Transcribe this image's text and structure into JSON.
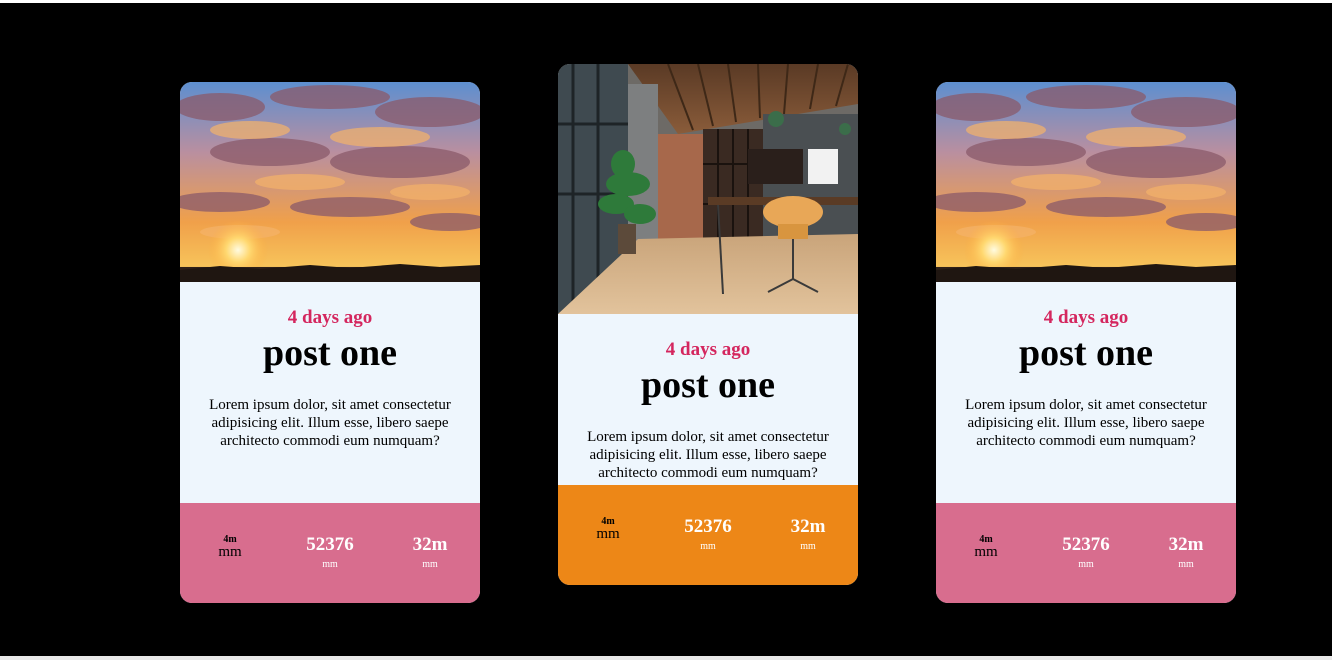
{
  "cards": [
    {
      "image": "sunset-photo",
      "date": "4 days ago",
      "title": "post one",
      "text": "Lorem ipsum dolor, sit amet consectetur adipisicing elit. Illum esse, libero saepe architecto commodi eum numquam?",
      "stats": [
        {
          "value": "4m",
          "unit": "mm"
        },
        {
          "value": "52376",
          "unit": "mm"
        },
        {
          "value": "32m",
          "unit": "mm"
        }
      ],
      "stats_color": "#d86d8e"
    },
    {
      "image": "office-interior-photo",
      "date": "4 days ago",
      "title": "post one",
      "text": "Lorem ipsum dolor, sit amet consectetur adipisicing elit. Illum esse, libero saepe architecto commodi eum numquam?",
      "stats": [
        {
          "value": "4m",
          "unit": "mm"
        },
        {
          "value": "52376",
          "unit": "mm"
        },
        {
          "value": "32m",
          "unit": "mm"
        }
      ],
      "stats_color": "#ed8717"
    },
    {
      "image": "sunset-photo",
      "date": "4 days ago",
      "title": "post one",
      "text": "Lorem ipsum dolor, sit amet consectetur adipisicing elit. Illum esse, libero saepe architecto commodi eum numquam?",
      "stats": [
        {
          "value": "4m",
          "unit": "mm"
        },
        {
          "value": "52376",
          "unit": "mm"
        },
        {
          "value": "32m",
          "unit": "mm"
        }
      ],
      "stats_color": "#d86d8e"
    }
  ],
  "colors": {
    "background": "#000000",
    "card_body": "#eef6fd",
    "date_accent": "#d4265e"
  }
}
